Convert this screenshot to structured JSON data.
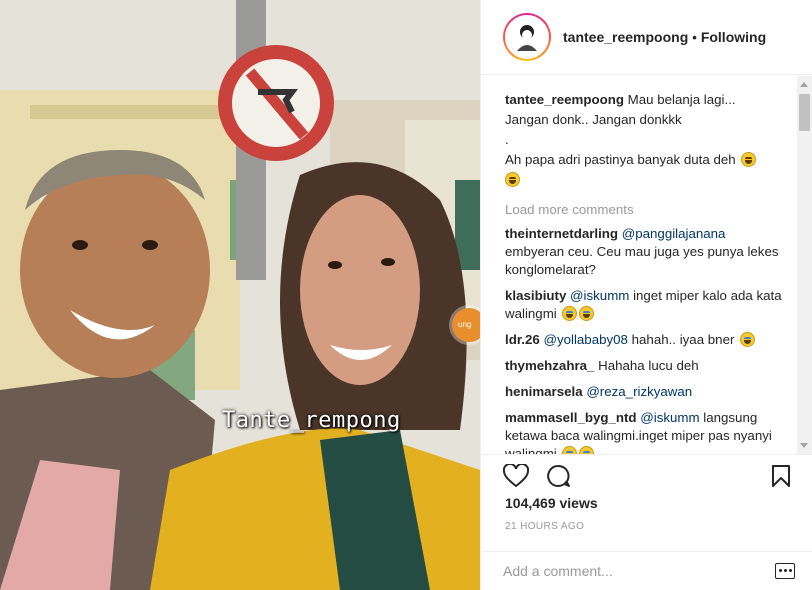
{
  "media": {
    "overlay_caption": "Tante_rempong",
    "badge_text": "ung"
  },
  "header": {
    "username": "tantee_reempoong",
    "separator": "•",
    "follow_status": "Following",
    "avatar_icon": "avatar-icon"
  },
  "caption": {
    "username": "tantee_reempoong",
    "line1": "Mau belanja lagi...",
    "line2": "Jangan donk.. Jangan donkkk",
    "line3": ".",
    "line4": "Ah papa adri pastinya banyak duta deh"
  },
  "load_more": "Load more comments",
  "comments": [
    {
      "username": "theinternetdarling",
      "mention": "@panggilajanana",
      "text": "embyeran ceu. Ceu mau juga yes punya lekes konglomelarat?"
    },
    {
      "username": "klasibiuty",
      "mention": "@iskumm",
      "text": "inget miper kalo ada kata walingmi"
    },
    {
      "username": "ldr.26",
      "mention": "@yollababy08",
      "text": "hahah.. iyaa bner"
    },
    {
      "username": "thymehzahra_",
      "mention": "",
      "text": "Hahaha lucu deh"
    },
    {
      "username": "henimarsela",
      "mention": "@reza_rizkyawan",
      "text": ""
    },
    {
      "username": "mammasell_byg_ntd",
      "mention": "@iskumm",
      "text": "langsung ketawa baca walingmi.inget miper pas nyanyi walingmi."
    }
  ],
  "stats": {
    "views": "104,469 views",
    "time": "21 HOURS AGO"
  },
  "add_comment": {
    "placeholder": "Add a comment..."
  },
  "icons": [
    "heart-icon",
    "comment-icon",
    "bookmark-icon",
    "more-icon"
  ]
}
